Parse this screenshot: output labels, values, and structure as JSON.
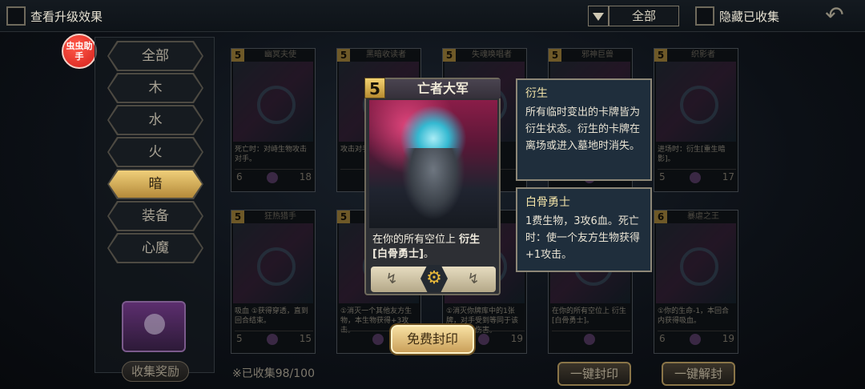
{
  "topbar": {
    "view_upgrade_label": "查看升级效果",
    "filter_value": "全部",
    "hide_collected_label": "隐藏已收集"
  },
  "helper_badge": "虫虫助手",
  "categories": [
    {
      "label": "全部",
      "active": false
    },
    {
      "label": "木",
      "active": false
    },
    {
      "label": "水",
      "active": false
    },
    {
      "label": "火",
      "active": false
    },
    {
      "label": "暗",
      "active": true
    },
    {
      "label": "装备",
      "active": false
    },
    {
      "label": "心魔",
      "active": false
    }
  ],
  "reward_label": "收集奖励",
  "grid_cards": [
    {
      "cost": "5",
      "name": "幽冥夫使",
      "desc": "死亡时：对峙生物攻击对手。",
      "atk": "6",
      "hp": "18"
    },
    {
      "cost": "5",
      "name": "黑暗收读者",
      "desc": "攻击对手时，弃1张牌",
      "atk": "",
      "hp": ""
    },
    {
      "cost": "5",
      "name": "失魂唤唱者",
      "desc": "一个",
      "atk": "",
      "hp": ""
    },
    {
      "cost": "5",
      "name": "邪神巨兽",
      "desc": "",
      "atk": "",
      "hp": ""
    },
    {
      "cost": "5",
      "name": "织影者",
      "desc": "进场时：衍生[重生暗影]。",
      "atk": "5",
      "hp": "17"
    },
    {
      "cost": "5",
      "name": "狂热猎手",
      "desc": "吸血 ①获得穿透，直到回合结束。",
      "atk": "5",
      "hp": "15"
    },
    {
      "cost": "5",
      "name": "",
      "desc": "①消灭一个其他友方生物，本生物获得+3攻击。",
      "atk": "",
      "hp": ""
    },
    {
      "cost": "5",
      "name": "",
      "desc": "①消灭你牌库中的1张牌，对手受到等同于该牌费用的伤害。",
      "atk": "",
      "hp": "19"
    },
    {
      "cost": "5",
      "name": "",
      "desc": "在你的所有空位上 衍生[白骨勇士]。",
      "atk": "",
      "hp": ""
    },
    {
      "cost": "6",
      "name": "暴虐之王",
      "desc": "①你的生命-1，本回合内获得吸血。",
      "atk": "6",
      "hp": "19"
    }
  ],
  "collected_text": "※已收集98/100",
  "buttons": {
    "seal_all": "一键封印",
    "unseal_all": "一键解封",
    "free_seal": "免费封印"
  },
  "featured_card": {
    "cost": "5",
    "title": "亡者大军",
    "text_prefix": "在你的所有空位上",
    "text_keyword": "衍生",
    "text_target": "[白骨勇士]",
    "text_suffix": "。"
  },
  "tooltips": [
    {
      "title": "衍生",
      "body": "所有临时变出的卡牌皆为衍生状态。衍生的卡牌在离场或进入墓地时消失。"
    },
    {
      "title": "白骨勇士",
      "body": "1费生物，3攻6血。死亡时：使一个友方生物获得+1攻击。"
    }
  ],
  "colors": {
    "accent": "#e8c26a",
    "tooltip_bg": "#1f2e3c",
    "helper_red": "#e0251e"
  }
}
